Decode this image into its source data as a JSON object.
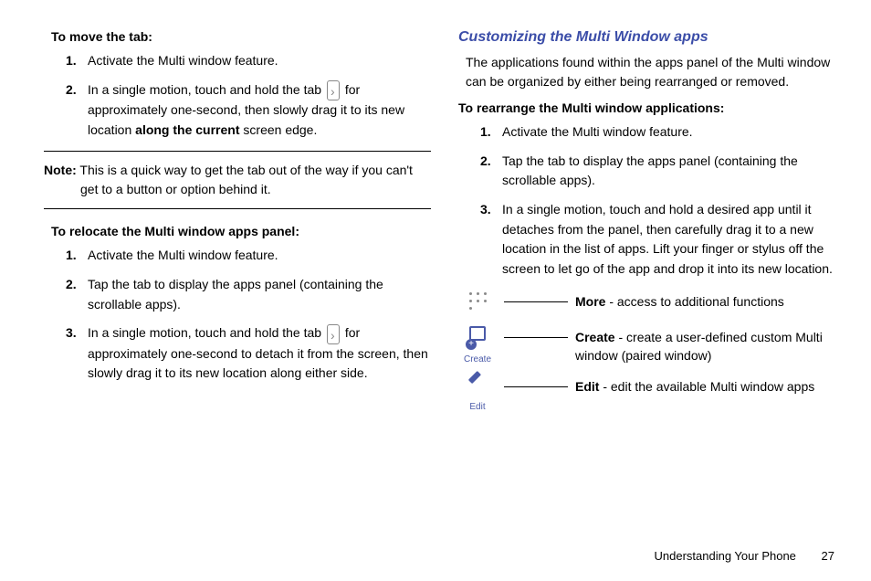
{
  "left": {
    "move_tab_heading": "To move the tab:",
    "move_tab_steps": [
      "Activate the Multi window feature.",
      {
        "pre": "In a single motion, touch and hold the tab ",
        "post": " for approximately one-second, then slowly drag it to its new location ",
        "bold": "along the current",
        "tail": " screen edge."
      }
    ],
    "note_label": "Note:",
    "note_text": " This is a quick way to get the tab out of the way if you can't get to a button or option behind it.",
    "relocate_heading": "To relocate the Multi window apps panel:",
    "relocate_steps": [
      "Activate the Multi window feature.",
      "Tap the tab to display the apps panel (containing the scrollable apps).",
      {
        "pre": "In a single motion, touch and hold the tab ",
        "post": " for approximately one-second to detach it from the screen, then slowly drag it to its new location along either side."
      }
    ]
  },
  "right": {
    "subheading": "Customizing the Multi Window apps",
    "intro": "The applications found within the apps panel of the Multi window can be organized by either being rearranged or removed.",
    "rearrange_heading": "To rearrange the Multi window applications:",
    "rearrange_steps": [
      "Activate the Multi window feature.",
      "Tap the tab to display the apps panel (containing the scrollable apps).",
      "In a single motion, touch and hold a desired app until it detaches from the panel, then carefully drag it to a new location in the list of apps. Lift your finger or stylus off the screen to let go of the app and drop it into its new location."
    ],
    "callouts": [
      {
        "icon_label": "",
        "bold": "More",
        "text": " - access to additional functions"
      },
      {
        "icon_label": "Create",
        "bold": "Create",
        "text": " - create a user-defined custom Multi window (paired window)"
      },
      {
        "icon_label": "Edit",
        "bold": "Edit",
        "text": " - edit the available Multi window apps"
      }
    ]
  },
  "footer": {
    "section": "Understanding Your Phone",
    "page": "27"
  }
}
